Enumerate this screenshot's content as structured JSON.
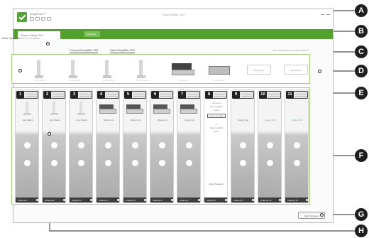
{
  "window": {
    "app_name": "AmpliFuse™",
    "title": "Room Setup Tool",
    "tab_active": "Room Setup Tool",
    "tab_secondary": "Overview"
  },
  "toolbar": {
    "icons": [
      "open-icon",
      "save-icon",
      "print-icon",
      "help-icon"
    ]
  },
  "sidebar": {
    "label": "Rear Speakers",
    "selector": "Select Amplifier"
  },
  "catalog_tabs": [
    "Compact Amplifier 500",
    "Stand Amplifier 500"
  ],
  "catalog_link": "Learn More about Compact Amplifiers",
  "catalog": {
    "items": [
      {
        "type": "stand",
        "caption": "Amp Stand 1"
      },
      {
        "type": "stand",
        "caption": "Amp Stand 2"
      },
      {
        "type": "stand",
        "caption": "Amp Stand 3"
      },
      {
        "type": "stand",
        "caption": "Amp Stand 4"
      },
      {
        "type": "device",
        "caption": "Mixer Unit"
      },
      {
        "type": "device-flat",
        "caption": "Power Unit"
      },
      {
        "type": "button",
        "caption": "Empty Slot"
      },
      {
        "type": "button",
        "caption": "Empty Slot"
      }
    ]
  },
  "channels": [
    {
      "num": "1",
      "kind": "stand",
      "caption": "Amp Stand",
      "footer": "Channel 1"
    },
    {
      "num": "2",
      "kind": "stand",
      "caption": "Amp Stand",
      "footer": "Channel 2"
    },
    {
      "num": "3",
      "kind": "stand",
      "caption": "Amp Stand",
      "footer": "Channel 3"
    },
    {
      "num": "4",
      "kind": "device",
      "caption": "Mixer Unit",
      "footer": "Channel 4"
    },
    {
      "num": "5",
      "kind": "device",
      "caption": "Mixer Unit",
      "footer": "Channel 5"
    },
    {
      "num": "6",
      "kind": "device",
      "caption": "Mixer Unit",
      "footer": "Channel 6"
    },
    {
      "num": "7",
      "kind": "device",
      "caption": "Mixer Unit",
      "footer": "Channel 7"
    },
    {
      "num": "8",
      "kind": "special",
      "caption": "Rear Speakers",
      "footer": "Channel 8",
      "lines": [
        "Connect to",
        "Rear Speaker",
        "Output",
        "",
        "Select Amplifier",
        "",
        "or",
        "Drag Amplifier",
        "Here"
      ]
    },
    {
      "num": "9",
      "kind": "empty",
      "caption": "Empty Slot",
      "footer": "Channel 9"
    },
    {
      "num": "10",
      "kind": "empty",
      "caption": "Empty Slot",
      "caption_color": "green",
      "footer": "Channel 10"
    },
    {
      "num": "11",
      "kind": "empty",
      "caption": "Empty Slot",
      "caption_color": "green",
      "footer": "Channel 11"
    }
  ],
  "bottom_button": "Apply Changes",
  "callouts": [
    "A",
    "B",
    "C",
    "D",
    "E",
    "F",
    "G",
    "H"
  ]
}
